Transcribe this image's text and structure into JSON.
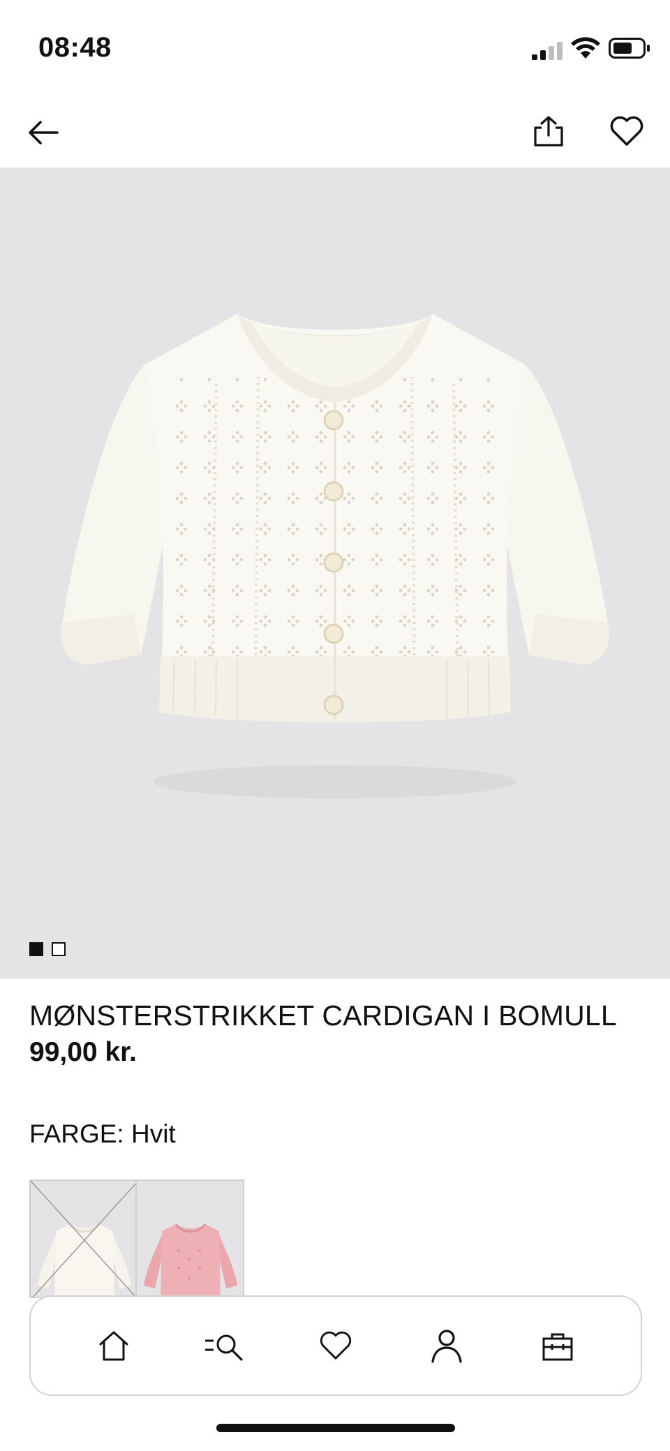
{
  "status_bar": {
    "time": "08:48",
    "signal_icon": "cellular-signal-icon",
    "wifi_icon": "wifi-icon",
    "battery_icon": "battery-icon"
  },
  "nav": {
    "back_icon": "arrow-left-icon",
    "share_icon": "share-icon",
    "favorite_icon": "heart-icon"
  },
  "gallery": {
    "image_count": 2,
    "active_index": 0,
    "background_color": "#e4e4e6"
  },
  "product": {
    "title": "MØNSTERSTRIKKET CARDIGAN I BOMULL",
    "price": "99,00 kr.",
    "color_label": "FARGE: Hvit",
    "swatches": [
      {
        "color": "#f6f3ea",
        "selected": true,
        "unavailable": true
      },
      {
        "color": "#eaa7ae",
        "selected": false,
        "unavailable": false
      }
    ]
  },
  "tab_bar": {
    "tabs": [
      {
        "icon": "home-icon"
      },
      {
        "icon": "search-icon"
      },
      {
        "icon": "heart-icon"
      },
      {
        "icon": "user-icon"
      },
      {
        "icon": "shopping-bag-icon"
      }
    ]
  }
}
